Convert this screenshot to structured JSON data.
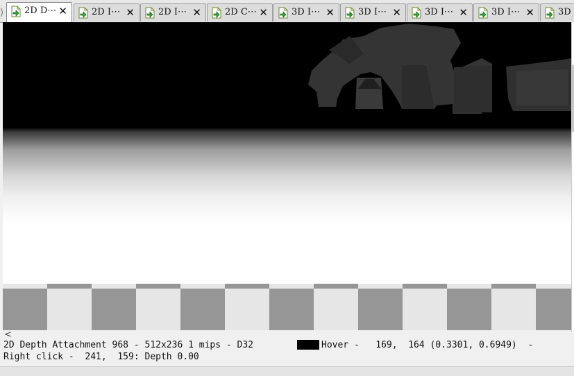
{
  "tabs": [
    {
      "label": "2D D⋯",
      "active": true
    },
    {
      "label": "2D I⋯",
      "active": false
    },
    {
      "label": "2D I⋯",
      "active": false
    },
    {
      "label": "2D C⋯",
      "active": false
    },
    {
      "label": "3D I⋯",
      "active": false
    },
    {
      "label": "3D I⋯",
      "active": false
    },
    {
      "label": "3D I⋯",
      "active": false
    },
    {
      "label": "3D I⋯",
      "active": false
    },
    {
      "label": "3D",
      "active": false
    }
  ],
  "tab_close_glyph": "✕",
  "tab_icon": "texture-viewer-icon",
  "status": {
    "line1_left": "2D Depth Attachment 968 - 512x236 1 mips - D32",
    "line1_right": "Hover -   169,  164 (0.3301, 0.6949)  -",
    "line2": "Right click -  241,  159: Depth 0.00",
    "swatch_color": "#000000"
  },
  "scroll_left_glyph": "<"
}
